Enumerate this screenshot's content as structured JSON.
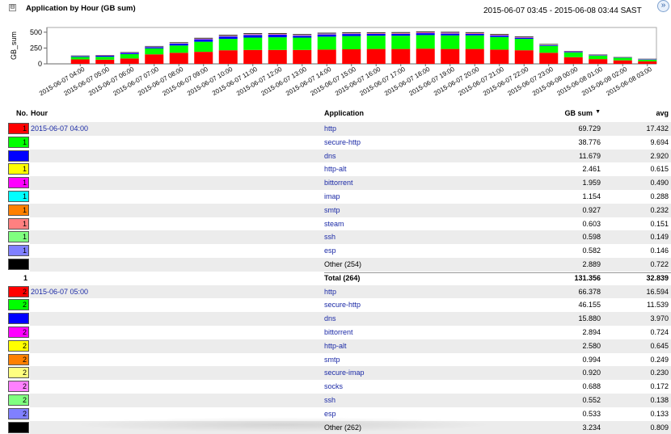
{
  "header": {
    "collapse_symbol": "⊟",
    "title": "Application by Hour  (GB sum)",
    "time_range": "2015-06-07 03:45   - 2015-06-08 03:44 SAST",
    "expand_icon": "chevron-double-down-icon"
  },
  "chart_data": {
    "type": "bar",
    "stacked": true,
    "ylabel": "GB_sum",
    "yticks": [
      0,
      250,
      500
    ],
    "ylim": [
      0,
      575
    ],
    "grid": false,
    "categories": [
      "2015-06-07 04:00",
      "2015-06-07 05:00",
      "2015-06-07 06:00",
      "2015-06-07 07:00",
      "2015-06-07 08:00",
      "2015-06-07 09:00",
      "2015-06-07 10:00",
      "2015-06-07 11:00",
      "2015-06-07 12:00",
      "2015-06-07 13:00",
      "2015-06-07 14:00",
      "2015-06-07 15:00",
      "2015-06-07 16:00",
      "2015-06-07 17:00",
      "2015-06-07 18:00",
      "2015-06-07 19:00",
      "2015-06-07 20:00",
      "2015-06-07 21:00",
      "2015-06-07 22:00",
      "2015-06-07 23:00",
      "2015-06-08 00:00",
      "2015-06-08 01:00",
      "2015-06-08 02:00",
      "2015-06-08 03:00"
    ],
    "series": [
      {
        "color": "#ff0000",
        "values": [
          70,
          66,
          85,
          150,
          175,
          190,
          215,
          220,
          220,
          220,
          225,
          230,
          235,
          235,
          240,
          235,
          235,
          225,
          215,
          175,
          105,
          75,
          55,
          40
        ]
      },
      {
        "color": "#00ff00",
        "values": [
          39,
          46,
          70,
          95,
          115,
          160,
          180,
          195,
          200,
          195,
          205,
          210,
          210,
          210,
          215,
          215,
          215,
          200,
          180,
          110,
          75,
          55,
          40,
          25
        ]
      },
      {
        "color": "#0000ff",
        "values": [
          12,
          16,
          18,
          20,
          30,
          38,
          38,
          42,
          40,
          30,
          35,
          32,
          28,
          30,
          30,
          28,
          24,
          22,
          18,
          12,
          10,
          8,
          6,
          6
        ]
      },
      {
        "color": "#ffff00",
        "values": [
          2,
          3,
          3,
          3,
          4,
          4,
          5,
          5,
          5,
          5,
          5,
          5,
          5,
          5,
          5,
          5,
          5,
          5,
          4,
          3,
          3,
          2,
          2,
          2
        ]
      },
      {
        "color": "#ff00ff",
        "values": [
          2,
          3,
          3,
          4,
          5,
          6,
          6,
          7,
          7,
          7,
          7,
          7,
          7,
          7,
          8,
          8,
          7,
          7,
          6,
          5,
          4,
          3,
          2,
          2
        ]
      },
      {
        "color": "#00ffff",
        "values": [
          1,
          1,
          1,
          2,
          2,
          2,
          2,
          2,
          2,
          2,
          2,
          2,
          2,
          2,
          2,
          2,
          2,
          2,
          2,
          2,
          1,
          1,
          1,
          1
        ]
      },
      {
        "color": "#ff8000",
        "values": [
          1,
          1,
          1,
          2,
          2,
          2,
          2,
          2,
          2,
          2,
          2,
          2,
          2,
          2,
          2,
          2,
          2,
          2,
          2,
          2,
          1,
          1,
          1,
          1
        ]
      },
      {
        "color": "#000000",
        "values": [
          4,
          4,
          5,
          6,
          8,
          9,
          10,
          10,
          10,
          9,
          10,
          10,
          10,
          10,
          11,
          10,
          10,
          9,
          8,
          6,
          5,
          4,
          3,
          3
        ]
      }
    ]
  },
  "table": {
    "columns": {
      "no": "No.",
      "hour": "Hour",
      "application": "Application",
      "gb_sum": "GB sum",
      "avg": "avg"
    },
    "sort_indicator": "▼",
    "rows": [
      {
        "color": "#ff0000",
        "no": "1",
        "hour": "2015-06-07 04:00",
        "app": "http",
        "gb": "69.729",
        "avg": "17.432",
        "alt": true
      },
      {
        "color": "#00ff00",
        "no": "1",
        "hour": "",
        "app": "secure-http",
        "gb": "38.776",
        "avg": "9.694",
        "alt": false
      },
      {
        "color": "#0000ff",
        "no": "1",
        "hour": "",
        "app": "dns",
        "gb": "11.679",
        "avg": "2.920",
        "alt": true
      },
      {
        "color": "#ffff00",
        "no": "1",
        "hour": "",
        "app": "http-alt",
        "gb": "2.461",
        "avg": "0.615",
        "alt": false
      },
      {
        "color": "#ff00ff",
        "no": "1",
        "hour": "",
        "app": "bittorrent",
        "gb": "1.959",
        "avg": "0.490",
        "alt": true
      },
      {
        "color": "#00ffff",
        "no": "1",
        "hour": "",
        "app": "imap",
        "gb": "1.154",
        "avg": "0.288",
        "alt": false
      },
      {
        "color": "#ff8000",
        "no": "1",
        "hour": "",
        "app": "smtp",
        "gb": "0.927",
        "avg": "0.232",
        "alt": true
      },
      {
        "color": "#ff8080",
        "no": "1",
        "hour": "",
        "app": "steam",
        "gb": "0.603",
        "avg": "0.151",
        "alt": false
      },
      {
        "color": "#80ff80",
        "no": "1",
        "hour": "",
        "app": "ssh",
        "gb": "0.598",
        "avg": "0.149",
        "alt": true
      },
      {
        "color": "#8080ff",
        "no": "1",
        "hour": "",
        "app": "esp",
        "gb": "0.582",
        "avg": "0.146",
        "alt": false
      },
      {
        "color": "#000000",
        "no": "1",
        "hour": "",
        "app": "Other (254)",
        "gb": "2.889",
        "avg": "0.722",
        "alt": true,
        "plain": true
      },
      {
        "color": "",
        "no": "1",
        "hour": "",
        "app": "Total (264)",
        "gb": "131.356",
        "avg": "32.839",
        "alt": false,
        "total": true
      },
      {
        "color": "#ff0000",
        "no": "2",
        "hour": "2015-06-07 05:00",
        "app": "http",
        "gb": "66.378",
        "avg": "16.594",
        "alt": true
      },
      {
        "color": "#00ff00",
        "no": "2",
        "hour": "",
        "app": "secure-http",
        "gb": "46.155",
        "avg": "11.539",
        "alt": false
      },
      {
        "color": "#0000ff",
        "no": "2",
        "hour": "",
        "app": "dns",
        "gb": "15.880",
        "avg": "3.970",
        "alt": true
      },
      {
        "color": "#ff00ff",
        "no": "2",
        "hour": "",
        "app": "bittorrent",
        "gb": "2.894",
        "avg": "0.724",
        "alt": false
      },
      {
        "color": "#ffff00",
        "no": "2",
        "hour": "",
        "app": "http-alt",
        "gb": "2.580",
        "avg": "0.645",
        "alt": true
      },
      {
        "color": "#ff8000",
        "no": "2",
        "hour": "",
        "app": "smtp",
        "gb": "0.994",
        "avg": "0.249",
        "alt": false
      },
      {
        "color": "#ffff80",
        "no": "2",
        "hour": "",
        "app": "secure-imap",
        "gb": "0.920",
        "avg": "0.230",
        "alt": true
      },
      {
        "color": "#ff80ff",
        "no": "2",
        "hour": "",
        "app": "socks",
        "gb": "0.688",
        "avg": "0.172",
        "alt": false
      },
      {
        "color": "#80ff80",
        "no": "2",
        "hour": "",
        "app": "ssh",
        "gb": "0.552",
        "avg": "0.138",
        "alt": true
      },
      {
        "color": "#8080ff",
        "no": "2",
        "hour": "",
        "app": "esp",
        "gb": "0.533",
        "avg": "0.133",
        "alt": false
      },
      {
        "color": "#000000",
        "no": "2",
        "hour": "",
        "app": "Other (262)",
        "gb": "3.234",
        "avg": "0.809",
        "alt": true,
        "plain": true
      }
    ]
  }
}
